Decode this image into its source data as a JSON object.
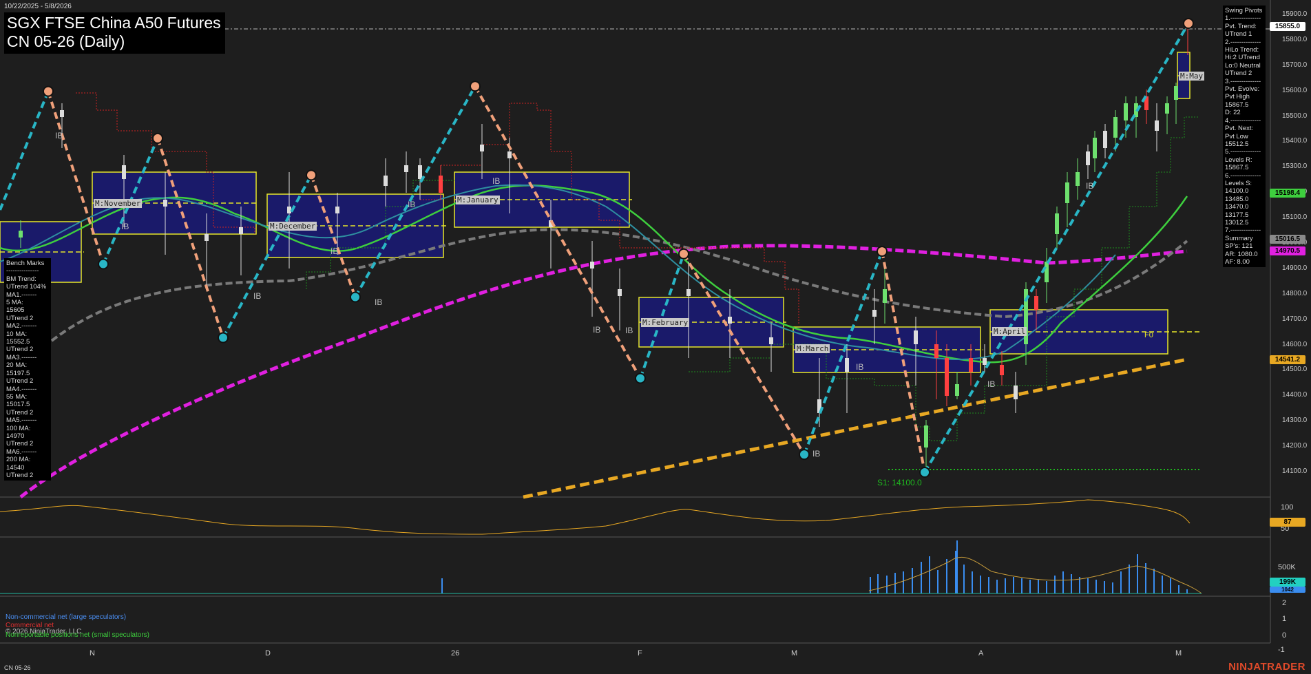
{
  "header": {
    "date_range": "10/22/2025 - 5/8/2026",
    "title_line1": "SGX FTSE China A50 Futures",
    "title_line2": "CN 05-26 (Daily)"
  },
  "swing_panel": {
    "lines": [
      "Swing Pivots",
      "1.--------------",
      "Pvt. Trend:",
      "UTrend 1",
      "2.--------------",
      "HiLo Trend:",
      "Hi:2 UTrend",
      "Lo:0 Neutral",
      "UTrend 2",
      "3.--------------",
      "Pvt. Evolve:",
      "Pvt High",
      "15867.5",
      "D: 22",
      "4.--------------",
      "Pvt. Next:",
      "Pvt Low",
      "15512.5",
      "5.--------------",
      "Levels R:",
      "15867.5",
      "6.--------------",
      "Levels S:",
      "14100.0",
      "13485.0",
      "13470.0",
      "13177.5",
      "13012.5",
      "7.--------------",
      "Summary",
      "SP's: 121",
      "AR: 1080.0",
      "AF: 8.00"
    ]
  },
  "bench_panel": {
    "lines": [
      "Bench Marks",
      "---------------",
      "BM Trend:",
      "UTrend 104%",
      "MA1.-------",
      "5 MA:",
      "15605",
      "UTrend 2",
      "MA2.-------",
      "10 MA:",
      "15552.5",
      "UTrend 2",
      "MA3.-------",
      "20 MA:",
      "15197.5",
      "UTrend 2",
      "MA4.-------",
      "55 MA:",
      "15017.5",
      "UTrend 2",
      "MA5.-------",
      "100 MA:",
      "14970",
      "UTrend 2",
      "MA6.-------",
      "200 MA:",
      "14540",
      "UTrend 2"
    ]
  },
  "price_axis": {
    "ticks": [
      "15900.0",
      "15800.0",
      "15700.0",
      "15600.0",
      "15500.0",
      "15400.0",
      "15300.0",
      "15200.0",
      "15100.0",
      "15000.0",
      "14900.0",
      "14800.0",
      "14700.0",
      "14600.0",
      "14500.0",
      "14400.0",
      "14300.0",
      "14200.0",
      "14100.0"
    ],
    "tags": [
      {
        "text": "15855.0",
        "color": "#ffffff"
      },
      {
        "text": "15198.4",
        "color": "#3ecf3e"
      },
      {
        "text": "15016.5",
        "color": "#8a8a8a"
      },
      {
        "text": "14970.5",
        "color": "#e020e0"
      },
      {
        "text": "14541.2",
        "color": "#e8a823"
      }
    ]
  },
  "oscillator": {
    "ticks": [
      "100",
      "50"
    ],
    "tag": "87",
    "tag_color": "#e8a823"
  },
  "volume": {
    "ticks": [
      "500K"
    ],
    "tag": "199K",
    "tag_color": "#22d0c0",
    "tag2": "1042"
  },
  "cot": {
    "ticks": [
      "2",
      "1",
      "0",
      "-1"
    ],
    "legend": [
      {
        "text": "Non-commercial net (large speculators)",
        "color": "#4a8df0"
      },
      {
        "text": "Commercial net",
        "color": "#e03030"
      },
      {
        "text": "Nonreportable positions net (small speculators)",
        "color": "#3ecf3e"
      }
    ],
    "copyright": "© 2026 NinjaTrader, LLC"
  },
  "time_axis": [
    "N",
    "D",
    "26",
    "F",
    "M",
    "A",
    "M"
  ],
  "month_labels": [
    "M:November",
    "M:December",
    "M:January",
    "M:February",
    "M:March",
    "M:April",
    "M:May"
  ],
  "annotations": {
    "support_label": "S1: 14100.0",
    "inside_bar": "IB",
    "f0": "F0"
  },
  "footer": {
    "symbol": "CN 05-26",
    "logo": "NINJATRADER"
  },
  "colors": {
    "background": "#1e1e1e",
    "ma_green": "#3ecf3e",
    "ma_magenta": "#e020e0",
    "ma_gray": "#7a7a7a",
    "trend_orange": "#e8a823",
    "swing_up": "#29b6c6",
    "swing_down": "#f0a07a",
    "month_box": "#1a1a6a",
    "month_border": "#e6e62a"
  },
  "chart_data": {
    "type": "line",
    "title": "SGX FTSE China A50 Futures CN 05-26 (Daily)",
    "ylim": [
      14000,
      15950
    ],
    "x": [
      "N",
      "D",
      "26",
      "F",
      "M",
      "A",
      "M"
    ],
    "swing_pivots": [
      {
        "x": "Oct-28",
        "y": 15600,
        "kind": "high"
      },
      {
        "x": "Nov-06",
        "y": 14920,
        "kind": "low"
      },
      {
        "x": "Nov-12",
        "y": 15415,
        "kind": "high"
      },
      {
        "x": "Nov-21",
        "y": 14630,
        "kind": "low"
      },
      {
        "x": "Dec-02",
        "y": 15270,
        "kind": "high"
      },
      {
        "x": "Dec-12",
        "y": 14790,
        "kind": "low"
      },
      {
        "x": "Jan-05",
        "y": 15620,
        "kind": "high"
      },
      {
        "x": "Jan-30",
        "y": 14470,
        "kind": "low"
      },
      {
        "x": "Feb-09",
        "y": 14960,
        "kind": "high"
      },
      {
        "x": "Mar-02",
        "y": 14170,
        "kind": "low"
      },
      {
        "x": "Mar-13",
        "y": 14970,
        "kind": "high"
      },
      {
        "x": "Mar-20",
        "y": 14100,
        "kind": "low"
      },
      {
        "x": "May-08",
        "y": 15867.5,
        "kind": "high"
      }
    ],
    "last_price": 15855.0
  }
}
